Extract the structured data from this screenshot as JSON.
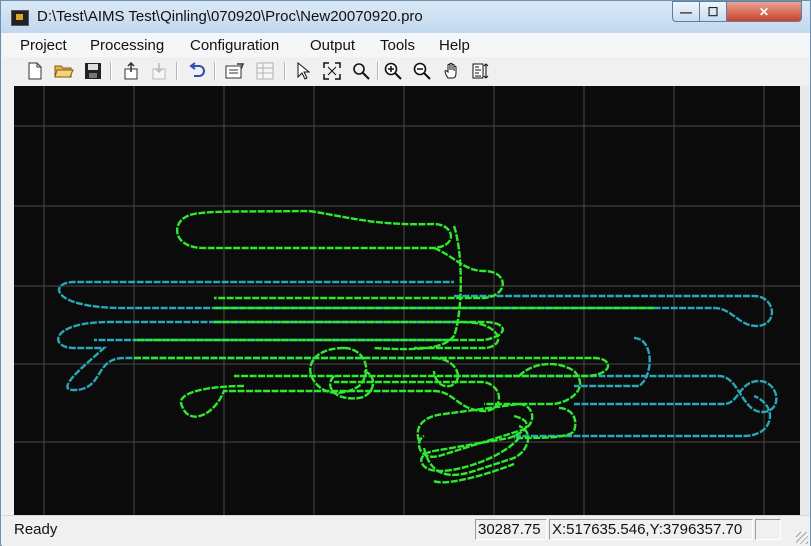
{
  "window": {
    "title": "D:\\Test\\AIMS Test\\Qinling\\070920\\Proc\\New20070920.pro",
    "minimize_glyph": "—",
    "maximize_glyph": "☐",
    "close_glyph": "✕"
  },
  "menu": {
    "items": [
      "Project",
      "Processing",
      "Configuration",
      "Output",
      "Tools",
      "Help"
    ]
  },
  "toolbar": {
    "icons": [
      "new-file-icon",
      "open-folder-icon",
      "save-disk-icon",
      "export-icon",
      "import-icon",
      "undo-icon",
      "properties-icon",
      "table-icon",
      "select-arrow-icon",
      "zoom-extent-icon",
      "zoom-box-icon",
      "zoom-in-icon",
      "zoom-out-icon",
      "pan-hand-icon",
      "measure-icon"
    ]
  },
  "statusbar": {
    "ready": "Ready",
    "scale": "30287.75",
    "coords": "X:517635.546,Y:3796357.70"
  },
  "plot": {
    "background": "#0b0b0b",
    "grid_color": "#4a4a4a",
    "track_colors": [
      "#2aa6b8",
      "#2fe82f"
    ]
  }
}
